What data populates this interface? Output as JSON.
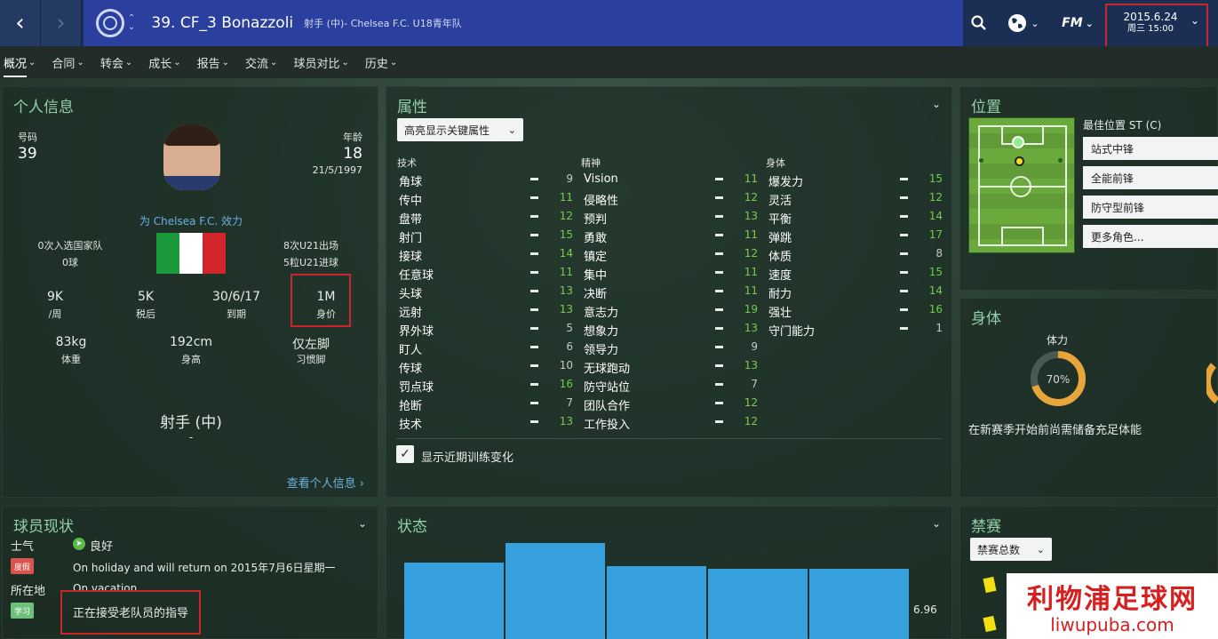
{
  "topbar": {
    "back_icon": "chevron-left-icon",
    "forward_icon": "chevron-right-icon",
    "player_title": "39. CF_3 Bonazzoli",
    "player_subtitle": "射手 (中)- Chelsea F.C. U18青年队",
    "date": "2015.6.24",
    "day_time": "周三 15:00",
    "fm_label": "FM"
  },
  "tabs": [
    "概况",
    "合同",
    "转会",
    "成长",
    "报告",
    "交流",
    "球员对比",
    "历史"
  ],
  "personal": {
    "title": "个人信息",
    "number_label": "号码",
    "number": "39",
    "age_label": "年龄",
    "age": "18",
    "dob": "21/5/1997",
    "plays_for": "为 Chelsea F.C. 效力",
    "caps_national": "0次入选国家队",
    "goals_national": "0球",
    "caps_u21": "8次U21出场",
    "goals_u21": "5粒U21进球",
    "wage": "9K",
    "wage_label": "/周",
    "release": "5K",
    "release_label": "税后",
    "contract_end": "30/6/17",
    "contract_label": "到期",
    "value": "1M",
    "value_label": "身价",
    "weight": "83kg",
    "weight_label": "体重",
    "height": "192cm",
    "height_label": "身高",
    "foot": "仅左脚",
    "foot_label": "习惯脚",
    "position": "射手 (中)",
    "position_sub": "-",
    "more_link": "查看个人信息 ›",
    "flag_colors": [
      "#1a9a3a",
      "#ffffff",
      "#d3262c"
    ]
  },
  "attributes": {
    "title": "属性",
    "highlight_btn": "高亮显示关键属性",
    "col_heads": [
      "技术",
      "精神",
      "身体"
    ],
    "technical": [
      {
        "n": "角球",
        "v": "9"
      },
      {
        "n": "传中",
        "v": "11"
      },
      {
        "n": "盘带",
        "v": "12"
      },
      {
        "n": "射门",
        "v": "15"
      },
      {
        "n": "接球",
        "v": "14"
      },
      {
        "n": "任意球",
        "v": "11"
      },
      {
        "n": "头球",
        "v": "13"
      },
      {
        "n": "远射",
        "v": "13"
      },
      {
        "n": "界外球",
        "v": "5"
      },
      {
        "n": "盯人",
        "v": "6"
      },
      {
        "n": "传球",
        "v": "10"
      },
      {
        "n": "罚点球",
        "v": "16"
      },
      {
        "n": "抢断",
        "v": "7"
      },
      {
        "n": "技术",
        "v": "13"
      }
    ],
    "mental": [
      {
        "n": "Vision",
        "v": "11"
      },
      {
        "n": "侵略性",
        "v": "12"
      },
      {
        "n": "预判",
        "v": "13"
      },
      {
        "n": "勇敢",
        "v": "11"
      },
      {
        "n": "镇定",
        "v": "12"
      },
      {
        "n": "集中",
        "v": "11"
      },
      {
        "n": "决断",
        "v": "11"
      },
      {
        "n": "意志力",
        "v": "19"
      },
      {
        "n": "想象力",
        "v": "13"
      },
      {
        "n": "领导力",
        "v": "9"
      },
      {
        "n": "无球跑动",
        "v": "13"
      },
      {
        "n": "防守站位",
        "v": "7"
      },
      {
        "n": "团队合作",
        "v": "12"
      },
      {
        "n": "工作投入",
        "v": "12"
      }
    ],
    "physical": [
      {
        "n": "爆发力",
        "v": "15"
      },
      {
        "n": "灵活",
        "v": "12"
      },
      {
        "n": "平衡",
        "v": "14"
      },
      {
        "n": "弹跳",
        "v": "17"
      },
      {
        "n": "体质",
        "v": "8"
      },
      {
        "n": "速度",
        "v": "15"
      },
      {
        "n": "耐力",
        "v": "14"
      },
      {
        "n": "强壮",
        "v": "16"
      },
      {
        "n": "守门能力",
        "v": "1"
      }
    ],
    "show_training": "显示近期训练变化"
  },
  "position_panel": {
    "title": "位置",
    "best_position": "最佳位置 ST (C)",
    "roles": [
      "站式中锋",
      "全能前锋",
      "防守型前锋",
      "更多角色..."
    ]
  },
  "body_panel": {
    "title": "身体",
    "stamina_label": "体力",
    "stamina_pct": "70%",
    "stamina_fraction": 0.7,
    "note": "在新赛季开始前尚需储备充足体能"
  },
  "status_panel": {
    "title": "球员现状",
    "morale_label": "士气",
    "morale_value": "良好",
    "holiday_tag": "度假",
    "holiday_text": "On holiday and will return on 2015年7月6日星期一",
    "location_label": "所在地",
    "location_value": "On vacation",
    "learn_tag": "学习",
    "learn_text": "正在接受老队员的指导"
  },
  "form_panel": {
    "title": "状态",
    "last_value": "6.96",
    "bars": [
      0.72,
      0.9,
      0.68,
      0.66,
      0.66
    ]
  },
  "ban_panel": {
    "title": "禁赛",
    "select": "禁赛总数"
  },
  "watermark": {
    "title": "利物浦足球网",
    "url": "liwupuba.com"
  }
}
